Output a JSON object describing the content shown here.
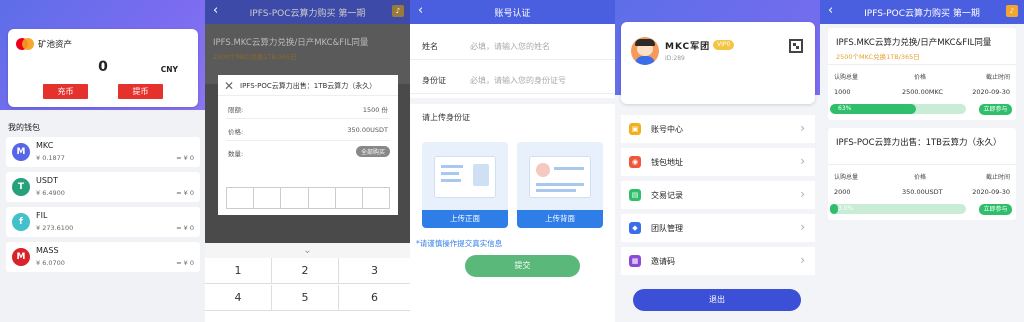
{
  "panel1": {
    "title": "矿池资产",
    "balance": "0",
    "currency": "CNY",
    "deposit_label": "充币",
    "withdraw_label": "提币",
    "wallet_title": "我的钱包",
    "wallets": [
      {
        "name": "MKC",
        "amount": "¥ 0.1877",
        "cny": "≈ ¥ 0",
        "icon": "M",
        "color": "#5566e8"
      },
      {
        "name": "USDT",
        "amount": "¥ 6.4900",
        "cny": "≈ ¥ 0",
        "icon": "T",
        "color": "#26a17b"
      },
      {
        "name": "FIL",
        "amount": "¥ 273.6100",
        "cny": "≈ ¥ 0",
        "icon": "f",
        "color": "#42c1ca"
      },
      {
        "name": "MASS",
        "amount": "¥ 6.0700",
        "cny": "≈ ¥ 0",
        "icon": "M",
        "color": "#d8232a"
      }
    ]
  },
  "panel2": {
    "title": "IPFS-POC云算力购买 第一期",
    "bg_title": "IPFS.MKC云算力兑换/日产MKC&FIL同量",
    "bg_sub": "2500个MKC兑换1TB/365日",
    "modal_title": "IPFS-POC云算力出售：1TB云算力（永久）",
    "rows": [
      {
        "label": "限额:",
        "value": "1500  份"
      },
      {
        "label": "价格:",
        "value": "350.00USDT"
      },
      {
        "label": "数量:",
        "value": ""
      }
    ],
    "buy_all_label": "全部购买",
    "keys": [
      "1",
      "2",
      "3",
      "4",
      "5",
      "6"
    ]
  },
  "panel3": {
    "title": "账号认证",
    "name_label": "姓名",
    "name_placeholder": "必填，请输入您的姓名",
    "id_label": "身份证",
    "id_placeholder": "必填，请输入您的身份证号",
    "upload_title": "请上传身份证",
    "front_label": "上传正面",
    "back_label": "上传背面",
    "notice": "*请谨慎操作提交真实信息",
    "submit_label": "提交"
  },
  "panel4": {
    "username": "MKC军团",
    "vip": "VIP0",
    "user_id": "ID:289",
    "menu": [
      {
        "label": "账号中心",
        "color": "#f2b01e",
        "icon": "▣"
      },
      {
        "label": "钱包地址",
        "color": "#f0573a",
        "icon": "◉"
      },
      {
        "label": "交易记录",
        "color": "#2fbf6b",
        "icon": "▤"
      },
      {
        "label": "团队管理",
        "color": "#3b6de8",
        "icon": "◆"
      },
      {
        "label": "邀请码",
        "color": "#8a4cd8",
        "icon": "▦"
      }
    ],
    "logout_label": "退出"
  },
  "panel5": {
    "title": "IPFS-POC云算力购买 第一期",
    "products": [
      {
        "title": "IPFS.MKC云算力兑换/日产MKC&FIL同量",
        "sub": "2500个MKC兑换1TB/365日",
        "headers": [
          "认购总量",
          "价格",
          "截止时间"
        ],
        "values": [
          "1000",
          "2500.00MKC",
          "2020-09-30"
        ],
        "progress_label": "63%",
        "progress": 0.63,
        "join_label": "立即参与"
      },
      {
        "title": "IPFS-POC云算力出售：1TB云算力（永久）",
        "sub": "",
        "headers": [
          "认购总量",
          "价格",
          "截止时间"
        ],
        "values": [
          "2000",
          "350.00USDT",
          "2020-09-30"
        ],
        "progress_label": "3.0%",
        "progress": 0.03,
        "join_label": "立即参与"
      }
    ]
  }
}
